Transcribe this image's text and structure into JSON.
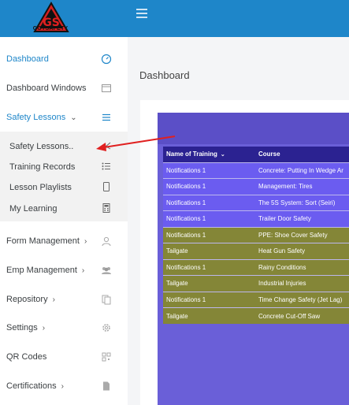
{
  "brand": {
    "logo_text": "GS",
    "tagline": "GOTSAFETY"
  },
  "header": {
    "menu_icon": "hamburger-icon"
  },
  "sidebar": {
    "items": [
      {
        "label": "Dashboard",
        "icon": "gauge-icon",
        "active": true
      },
      {
        "label": "Dashboard Windows",
        "icon": "window-icon"
      },
      {
        "label": "Safety Lessons",
        "icon": "list-icon",
        "chevron": "⌄"
      },
      {
        "label": "Form Management",
        "icon": "user-icon",
        "chevron": "›"
      },
      {
        "label": "Emp Management",
        "icon": "users-icon",
        "chevron": "›"
      },
      {
        "label": "Repository",
        "icon": "copy-icon",
        "chevron": "›"
      },
      {
        "label": "Settings",
        "icon": "gear-icon",
        "chevron": "›"
      },
      {
        "label": "QR Codes",
        "icon": "qr-icon"
      },
      {
        "label": "Certifications",
        "icon": "document-icon",
        "chevron": "›"
      }
    ],
    "submenu": [
      {
        "label": "Safety Lessons..",
        "icon": "scissors-icon"
      },
      {
        "label": "Training Records",
        "icon": "bullet-list-icon"
      },
      {
        "label": "Lesson Playlists",
        "icon": "tablet-icon"
      },
      {
        "label": "My Learning",
        "icon": "calculator-icon"
      }
    ]
  },
  "main": {
    "title": "Dashboard",
    "table": {
      "columns": [
        "Name of Training",
        "Course"
      ],
      "sort_indicator": "⌄",
      "rows": [
        {
          "name": "Notifications 1",
          "course": "Concrete: Putting In Wedge Ar",
          "type": "notif"
        },
        {
          "name": "Notifications 1",
          "course": "Management: Tires",
          "type": "notif"
        },
        {
          "name": "Notifications 1",
          "course": "The 5S System: Sort (Seiri)",
          "type": "notif"
        },
        {
          "name": "Notifications 1",
          "course": "Trailer Door Safety",
          "type": "notif"
        },
        {
          "name": "Notifications 1",
          "course": "PPE: Shoe Cover Safety",
          "type": "tailgate"
        },
        {
          "name": "Tailgate",
          "course": "Heat Gun Safety",
          "type": "tailgate"
        },
        {
          "name": "Notifications 1",
          "course": "Rainy Conditions",
          "type": "tailgate"
        },
        {
          "name": "Tailgate",
          "course": "Industrial Injuries",
          "type": "tailgate"
        },
        {
          "name": "Notifications 1",
          "course": "Time Change Safety (Jet Lag)",
          "type": "tailgate"
        },
        {
          "name": "Tailgate",
          "course": "Concrete Cut-Off Saw",
          "type": "tailgate"
        }
      ]
    }
  },
  "colors": {
    "header": "#1e86c9",
    "panel": "#6a5fd8",
    "table_header": "#2b2291",
    "row_notification": "#6b5cf0",
    "row_olive": "#848637",
    "annotation_arrow": "#e02020"
  }
}
